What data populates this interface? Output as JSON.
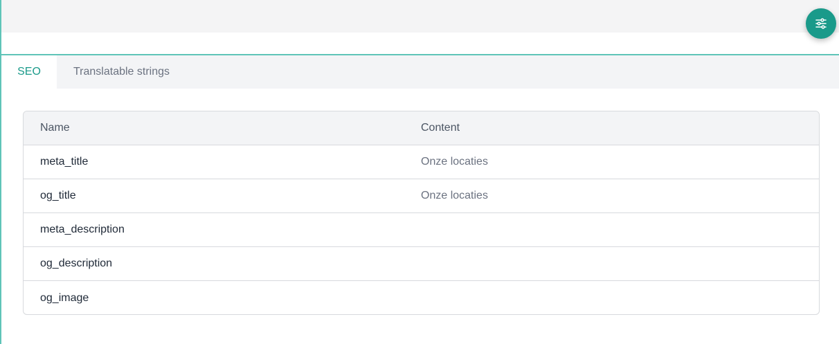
{
  "tabs": [
    {
      "label": "SEO",
      "active": true
    },
    {
      "label": "Translatable strings",
      "active": false
    }
  ],
  "table": {
    "columns": [
      "Name",
      "Content"
    ],
    "rows": [
      {
        "name": "meta_title",
        "content": "Onze locaties"
      },
      {
        "name": "og_title",
        "content": "Onze locaties"
      },
      {
        "name": "meta_description",
        "content": ""
      },
      {
        "name": "og_description",
        "content": ""
      },
      {
        "name": "og_image",
        "content": ""
      }
    ]
  },
  "colors": {
    "accent": "#1a9a8a",
    "rail": "#5fc4b8",
    "header_bg": "#f3f4f6"
  },
  "icons": {
    "fab": "sliders-icon"
  }
}
